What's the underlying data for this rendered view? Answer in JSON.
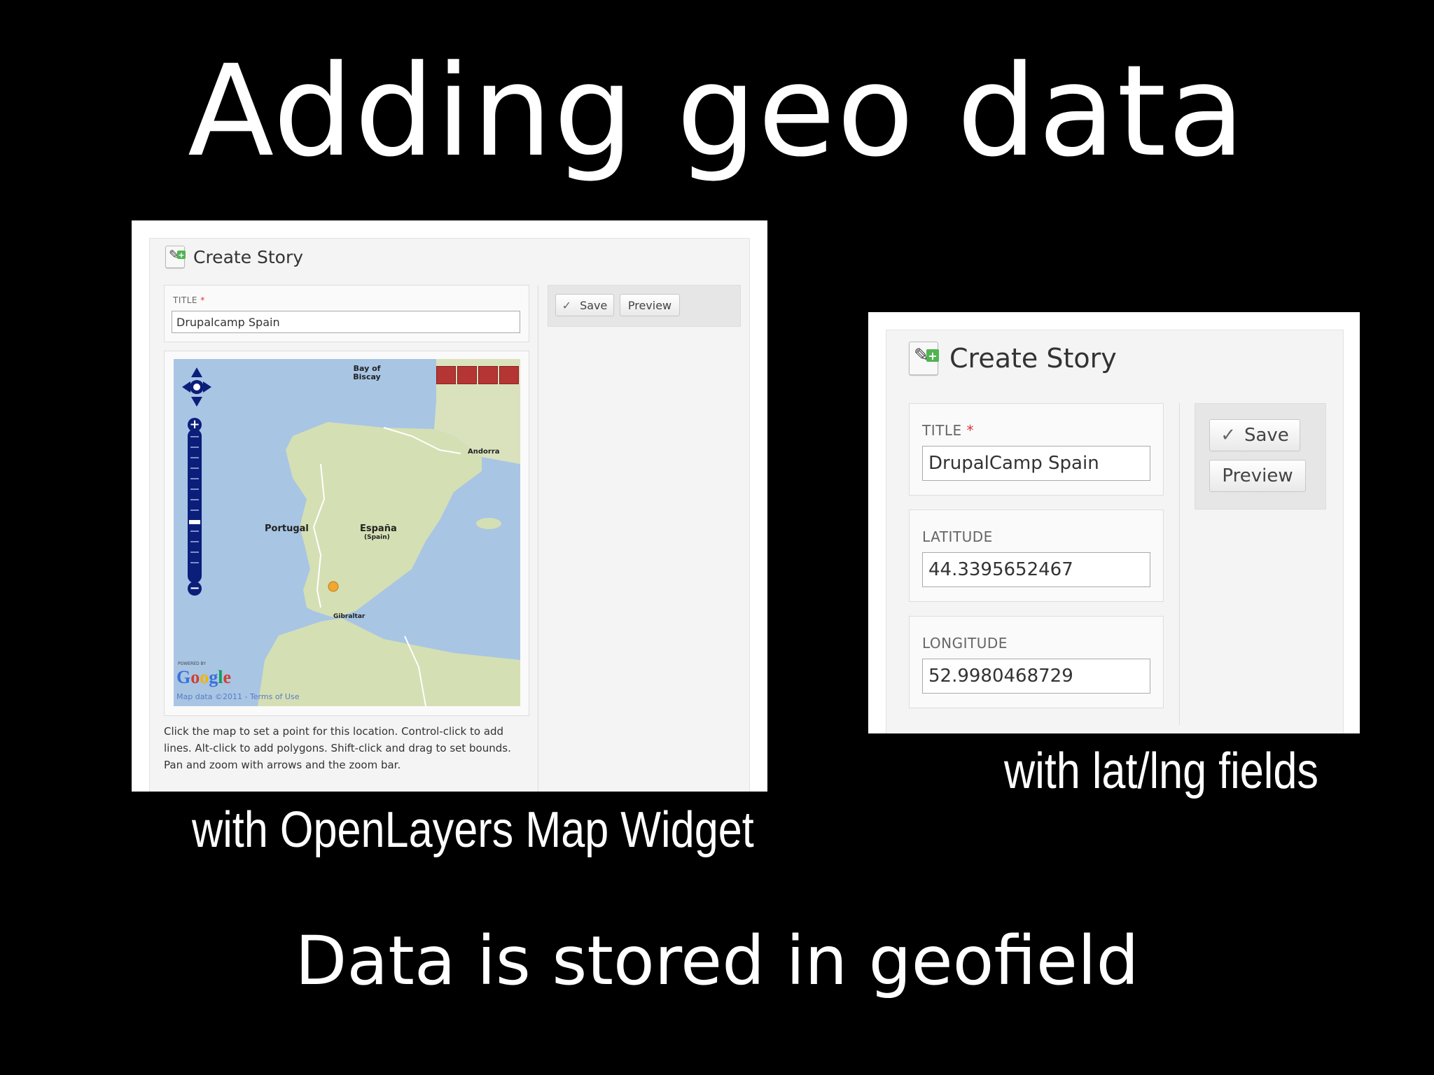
{
  "slide": {
    "title": "Adding geo data",
    "caption_left": "with OpenLayers Map Widget",
    "caption_right": "with lat/lng fields",
    "footer": "Data is stored in geofield"
  },
  "left_shot": {
    "page_title": "Create Story",
    "title_label": "Title",
    "required_mark": "*",
    "title_value": "Drupalcamp Spain",
    "save_label": "Save",
    "preview_label": "Preview",
    "map": {
      "labels": {
        "bay": "Bay of Biscay",
        "andorra": "Andorra",
        "portugal": "Portugal",
        "espana": "España",
        "spain": "(Spain)",
        "gibraltar": "Gibraltar"
      },
      "powered_by": "POWERED BY",
      "google": "Google",
      "attribution": "Map data ©2011 - Terms of Use"
    },
    "help_text": "Click the map to set a point for this location. Control-click to add lines. Alt-click to add polygons. Shift-click and drag to set bounds. Pan and zoom with arrows and the zoom bar."
  },
  "right_shot": {
    "page_title": "Create Story",
    "title_label": "Title",
    "required_mark": "*",
    "title_value": "DrupalCamp Spain",
    "latitude_label": "Latitude",
    "latitude_value": "44.3395652467",
    "longitude_label": "Longitude",
    "longitude_value": "52.9980468729",
    "save_label": "Save",
    "preview_label": "Preview"
  },
  "colors": {
    "background": "#000000",
    "text": "#ffffff",
    "map_water": "#a8c5e4",
    "map_land": "#d9e2bd",
    "zoom_control": "#0b1e7a",
    "layer_switcher": "#b53535",
    "required": "#dd3333"
  },
  "icons": [
    "create-content-icon",
    "pan-control-icon",
    "zoom-in-icon",
    "zoom-out-icon",
    "checkmark-icon",
    "location-marker-icon"
  ]
}
